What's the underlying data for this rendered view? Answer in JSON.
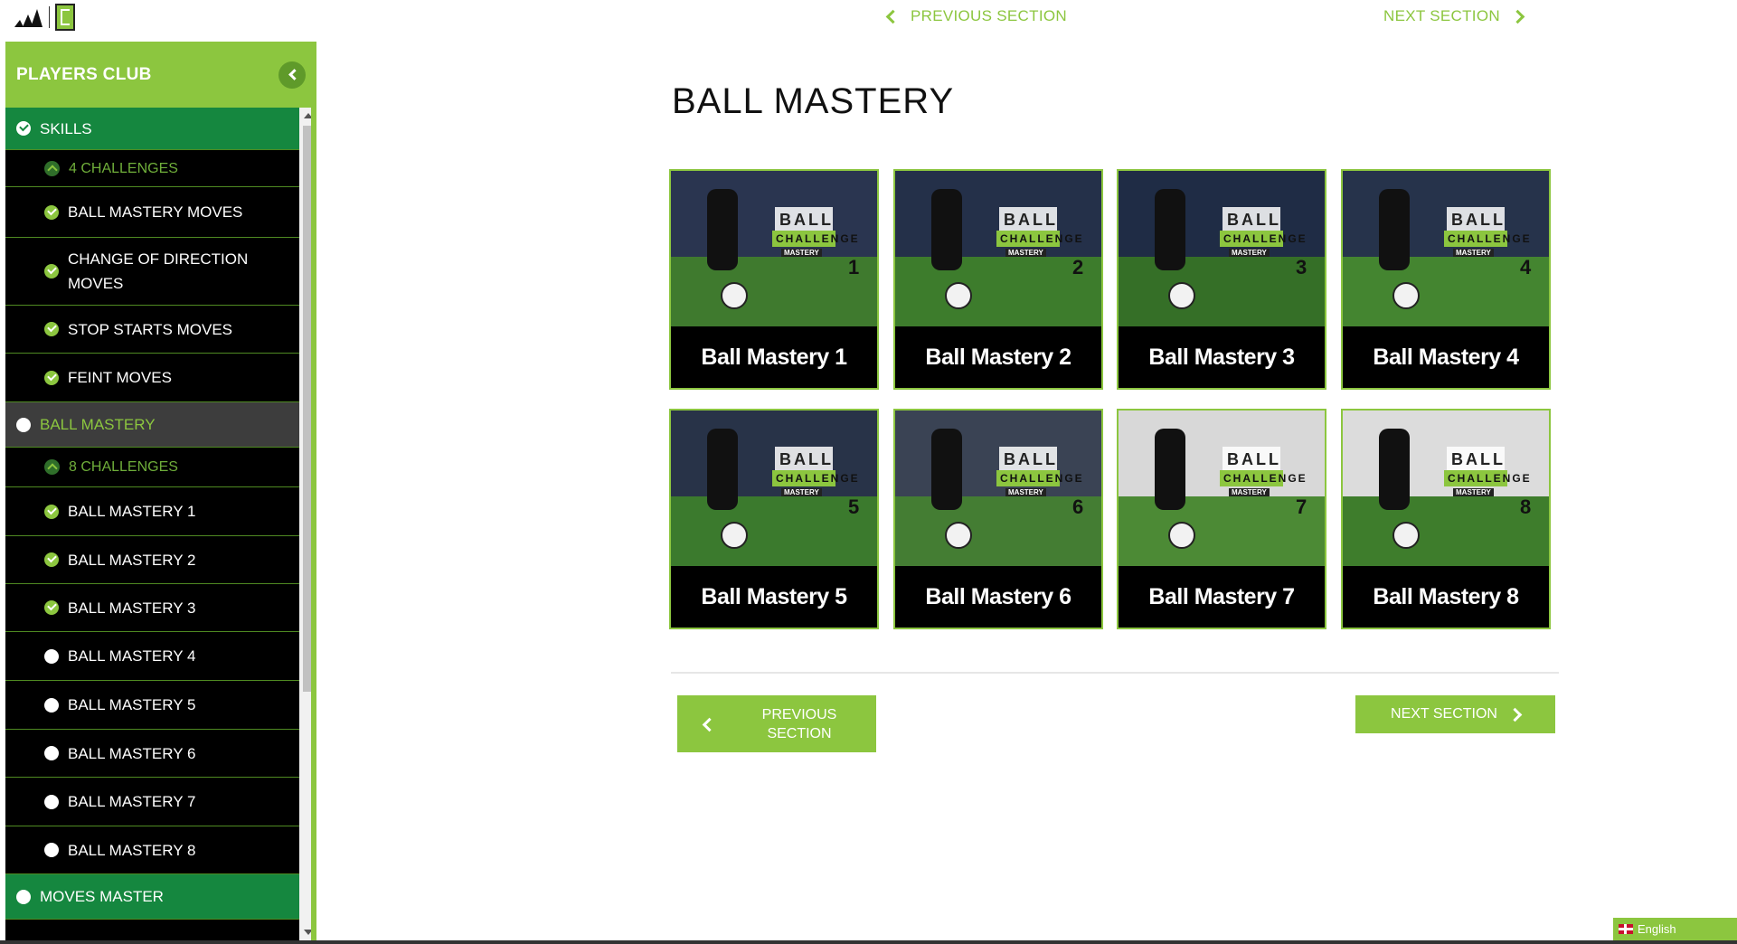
{
  "top_nav": {
    "previous": "PREVIOUS SECTION",
    "next": "NEXT SECTION"
  },
  "sidebar": {
    "title": "PLAYERS CLUB",
    "items": [
      {
        "label": "SKILLS",
        "kind": "section",
        "icon": "check-icon"
      },
      {
        "label": "4 CHALLENGES",
        "kind": "challenges",
        "icon": "chevron-up-icon"
      },
      {
        "label": "BALL MASTERY MOVES",
        "kind": "sub",
        "icon": "check-icon"
      },
      {
        "label": "CHANGE OF DIRECTION MOVES",
        "kind": "sub",
        "icon": "check-icon"
      },
      {
        "label": "STOP STARTS MOVES",
        "kind": "sub",
        "icon": "check-icon"
      },
      {
        "label": "FEINT MOVES",
        "kind": "sub",
        "icon": "check-icon"
      },
      {
        "label": "BALL MASTERY",
        "kind": "section-active",
        "icon": "dot-icon"
      },
      {
        "label": "8 CHALLENGES",
        "kind": "challenges",
        "icon": "chevron-up-icon"
      },
      {
        "label": "BALL MASTERY 1",
        "kind": "sub",
        "icon": "check-icon"
      },
      {
        "label": "BALL MASTERY 2",
        "kind": "sub",
        "icon": "check-icon"
      },
      {
        "label": "BALL MASTERY 3",
        "kind": "sub",
        "icon": "check-icon"
      },
      {
        "label": "BALL MASTERY 4",
        "kind": "sub",
        "icon": "dot-icon"
      },
      {
        "label": "BALL MASTERY 5",
        "kind": "sub",
        "icon": "dot-icon"
      },
      {
        "label": "BALL MASTERY 6",
        "kind": "sub",
        "icon": "dot-icon"
      },
      {
        "label": "BALL MASTERY 7",
        "kind": "sub",
        "icon": "dot-icon"
      },
      {
        "label": "BALL MASTERY 8",
        "kind": "sub",
        "icon": "dot-icon"
      },
      {
        "label": "MOVES MASTER",
        "kind": "section",
        "icon": "dot-icon"
      }
    ]
  },
  "main": {
    "title": "BALL MASTERY",
    "cards": [
      {
        "label": "Ball Mastery 1",
        "number": "1"
      },
      {
        "label": "Ball Mastery 2",
        "number": "2"
      },
      {
        "label": "Ball Mastery 3",
        "number": "3"
      },
      {
        "label": "Ball Mastery 4",
        "number": "4"
      },
      {
        "label": "Ball Mastery 5",
        "number": "5"
      },
      {
        "label": "Ball Mastery 6",
        "number": "6"
      },
      {
        "label": "Ball Mastery 7",
        "number": "7"
      },
      {
        "label": "Ball Mastery 8",
        "number": "8"
      }
    ],
    "thumb_text": {
      "ball": "BALL",
      "mastery": "MASTERY",
      "challenge": "CHALLENGE"
    }
  },
  "buttons": {
    "previous": "PREVIOUS SECTION",
    "next": "NEXT SECTION"
  },
  "language": {
    "label": "English"
  },
  "colors": {
    "accent": "#8cc63f",
    "section_green": "#15873f",
    "sidebar_bg": "#000000"
  }
}
